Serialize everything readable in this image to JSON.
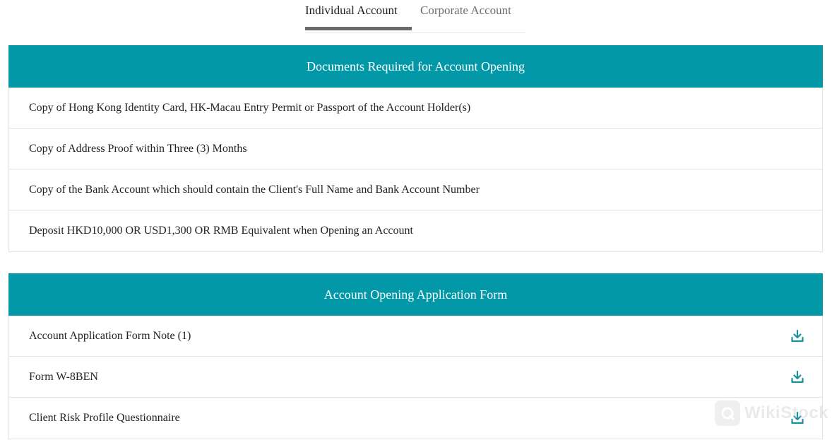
{
  "tabs": [
    {
      "label": "Individual Account",
      "active": true
    },
    {
      "label": "Corporate Account",
      "active": false
    }
  ],
  "documents_section": {
    "title": "Documents Required for Account Opening",
    "items": [
      "Copy of Hong Kong Identity Card, HK-Macau Entry Permit or Passport of the Account Holder(s)",
      "Copy of Address Proof within Three (3) Months",
      "Copy of the Bank Account which should contain the Client's Full Name and Bank Account Number",
      "Deposit HKD10,000 OR USD1,300 OR RMB Equivalent when Opening an Account"
    ]
  },
  "forms_section": {
    "title": "Account Opening Application Form",
    "items": [
      {
        "label": "Account Application Form Note (1)",
        "icon": "download-icon"
      },
      {
        "label": "Form W-8BEN",
        "icon": "download-icon"
      },
      {
        "label": "Client Risk Profile Questionnaire",
        "icon": "download-icon"
      }
    ]
  },
  "watermark": {
    "text": "WikiStock"
  },
  "colors": {
    "header_bg": "#0398a8",
    "icon": "#1a8fa0",
    "active_tab_underline": "#6a6a6a"
  }
}
